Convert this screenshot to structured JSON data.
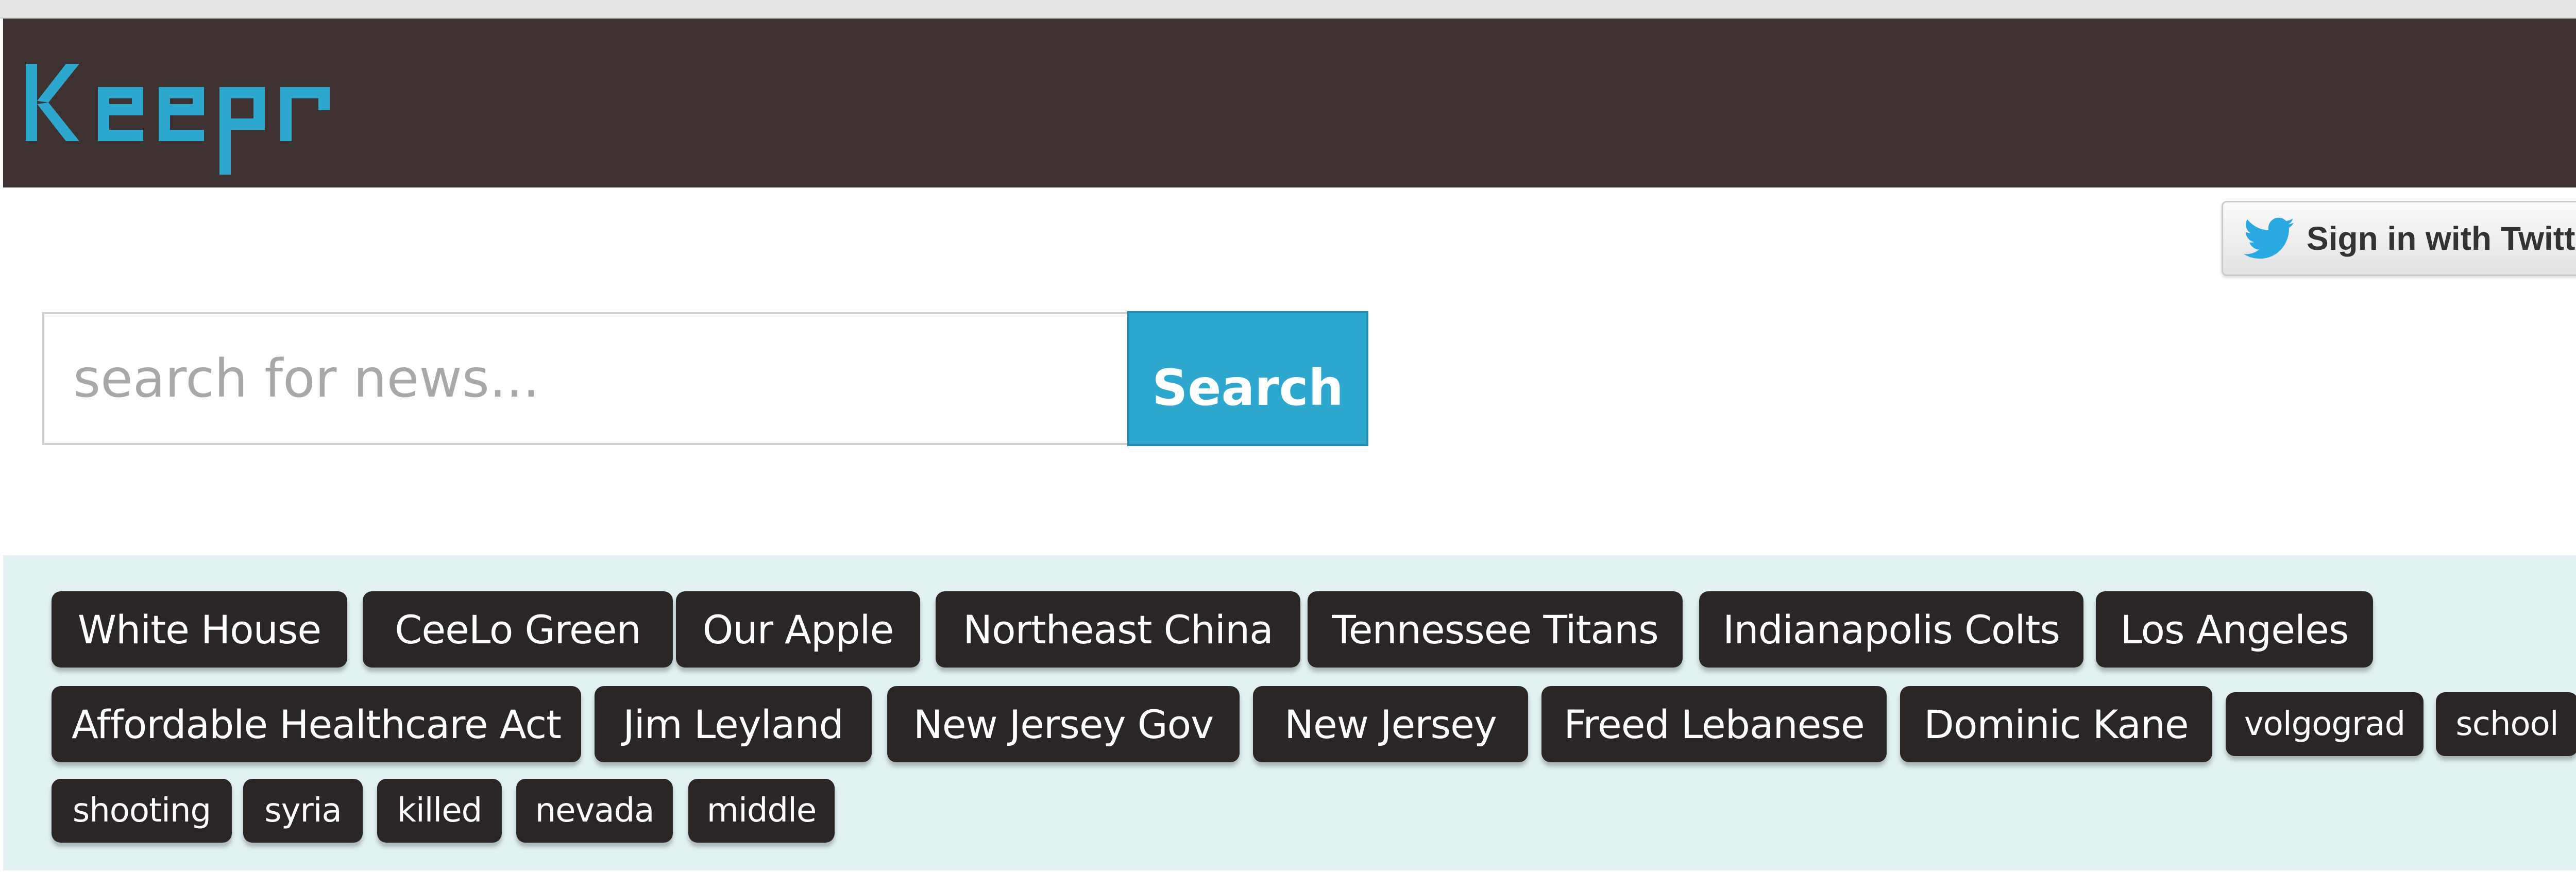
{
  "header": {
    "logo_text": "Keepr",
    "brand_color": "#2ea7cf",
    "background_color": "#3d3231"
  },
  "auth": {
    "twitter_button_label": "Sign in with Twitter",
    "twitter_icon": "twitter-bird-icon"
  },
  "search": {
    "placeholder": "search for news...",
    "value": "",
    "button_label": "Search"
  },
  "tags": [
    "White House",
    "CeeLo Green",
    "Our Apple",
    "Northeast China",
    "Tennessee Titans",
    "Indianapolis Colts",
    "Los Angeles",
    "Affordable Healthcare Act",
    "Jim Leyland",
    "New Jersey Gov",
    "New Jersey",
    "Freed Lebanese",
    "Dominic Kane",
    "volgograd",
    "school",
    "shooting",
    "syria",
    "killed",
    "nevada",
    "middle"
  ]
}
